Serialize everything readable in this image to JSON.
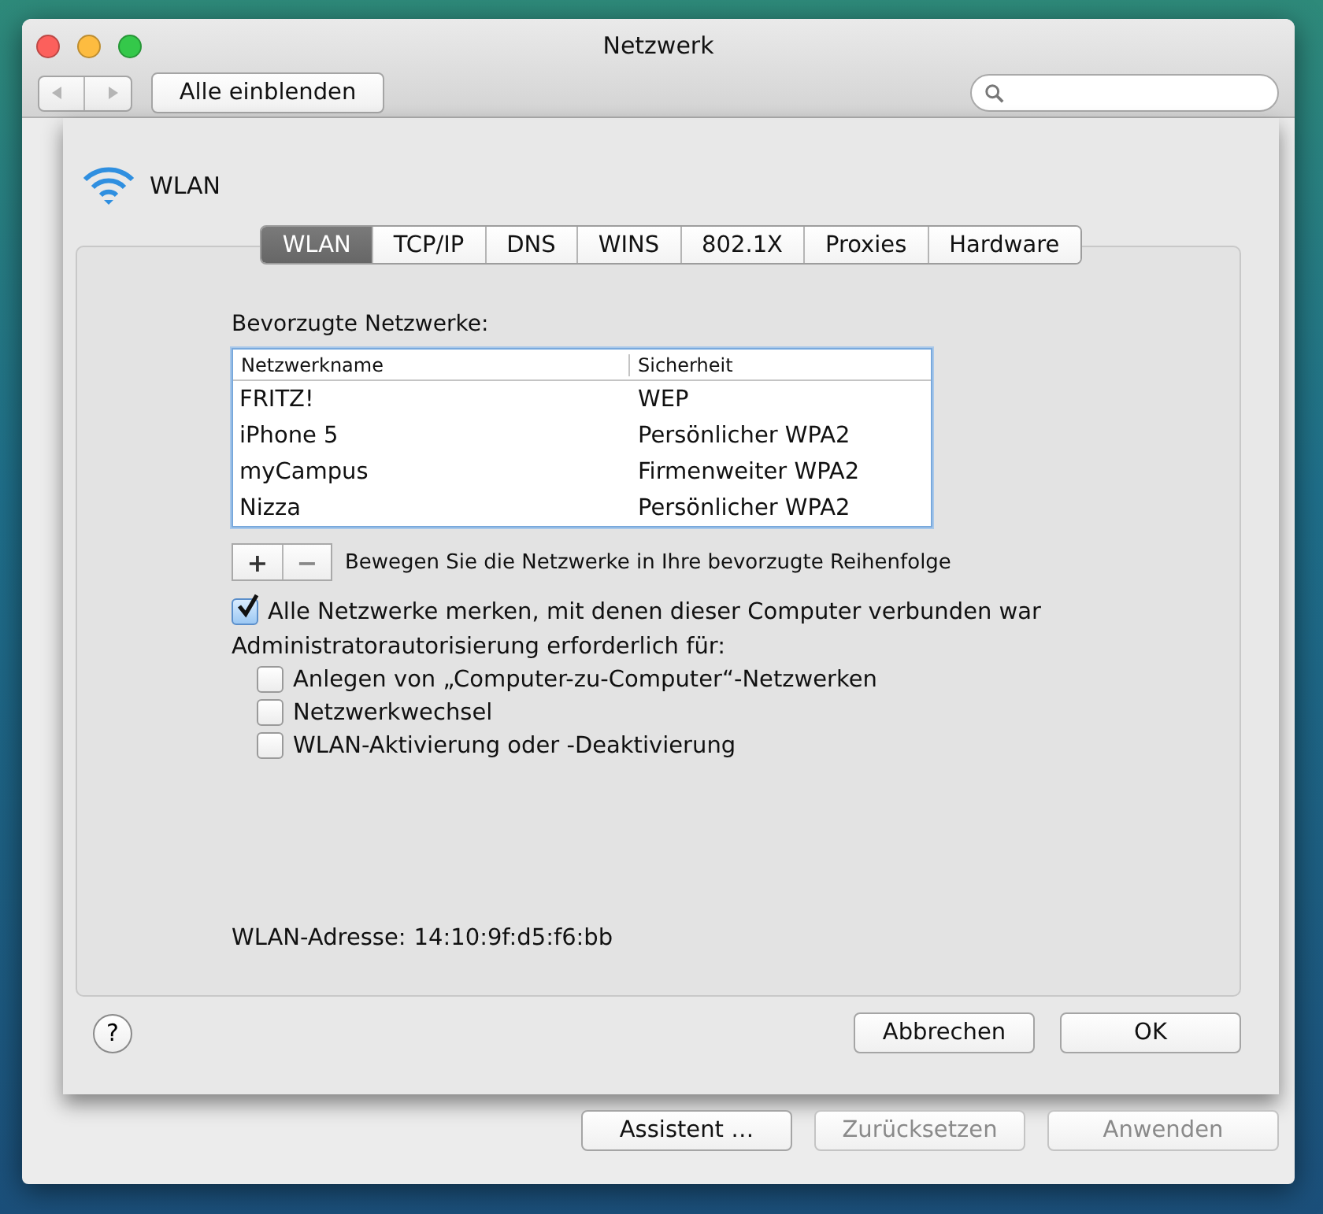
{
  "window": {
    "title": "Netzwerk",
    "show_all_button": "Alle einblenden"
  },
  "sheet": {
    "service": "WLAN",
    "tabs": [
      {
        "label": "WLAN",
        "selected": true
      },
      {
        "label": "TCP/IP",
        "selected": false
      },
      {
        "label": "DNS",
        "selected": false
      },
      {
        "label": "WINS",
        "selected": false
      },
      {
        "label": "802.1X",
        "selected": false
      },
      {
        "label": "Proxies",
        "selected": false
      },
      {
        "label": "Hardware",
        "selected": false
      }
    ],
    "preferred_label": "Bevorzugte Netzwerke:",
    "table": {
      "columns": [
        "Netzwerkname",
        "Sicherheit"
      ],
      "rows": [
        {
          "name": "FRITZ!",
          "security": "WEP"
        },
        {
          "name": "iPhone 5",
          "security": "Persönlicher WPA2"
        },
        {
          "name": "myCampus",
          "security": "Firmenweiter WPA2"
        },
        {
          "name": "Nizza",
          "security": "Persönlicher WPA2"
        }
      ]
    },
    "list_buttons": [
      "+",
      "−"
    ],
    "order_hint": "Bewegen Sie die Netzwerke in Ihre bevorzugte Reihenfolge",
    "remember": {
      "label": "Alle Netzwerke merken, mit denen dieser Computer verbunden war",
      "checked": true
    },
    "admin_label": "Administratorautorisierung erforderlich für:",
    "admin_options": [
      {
        "label": "Anlegen von „Computer-zu-Computer“-Netzwerken",
        "checked": false
      },
      {
        "label": "Netzwerkwechsel",
        "checked": false
      },
      {
        "label": "WLAN-Aktivierung oder -Deaktivierung",
        "checked": false
      }
    ],
    "address": {
      "label": "WLAN-Adresse:",
      "value": "14:10:9f:d5:f6:bb"
    },
    "help": "?",
    "buttons": [
      "Abbrechen",
      "OK"
    ]
  },
  "footer_buttons": [
    {
      "label": "Assistent …",
      "disabled": false
    },
    {
      "label": "Zurücksetzen",
      "disabled": true
    },
    {
      "label": "Anwenden",
      "disabled": true
    }
  ]
}
